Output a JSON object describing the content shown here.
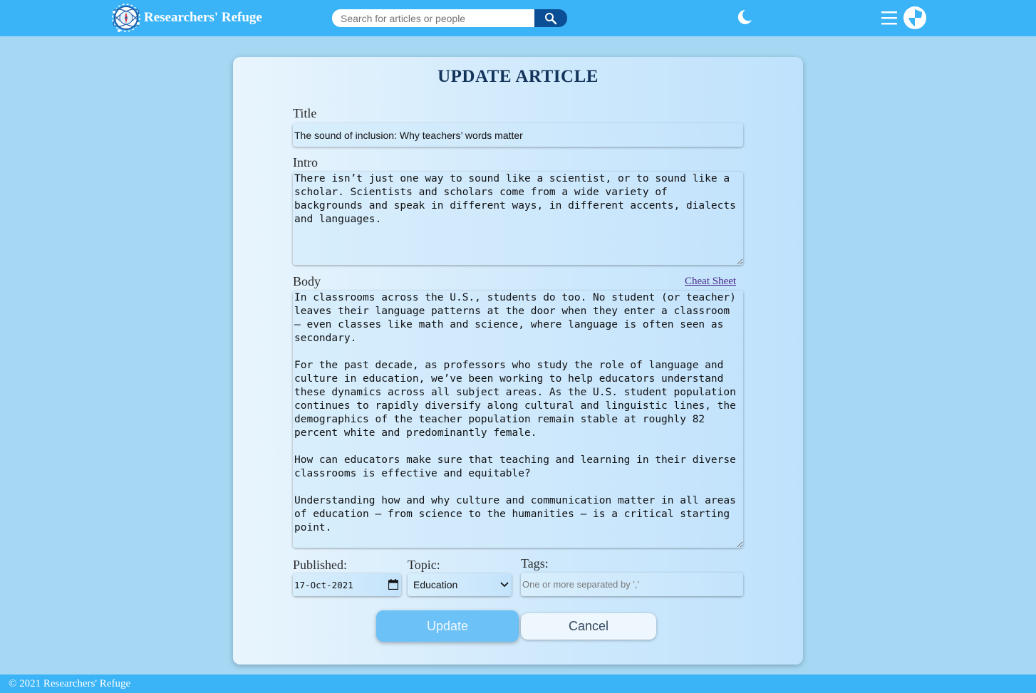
{
  "header": {
    "brand": "Researchers' Refuge",
    "search": {
      "placeholder": "Search for articles or people",
      "value": ""
    },
    "icons": [
      "logo-icon",
      "search-icon",
      "moon-icon",
      "menu-icon",
      "shield-icon"
    ]
  },
  "form": {
    "heading": "UPDATE ARTICLE",
    "title_label": "Title",
    "title_value": "The sound of inclusion: Why teachers’ words matter",
    "intro_label": "Intro",
    "intro_value": "There isn’t just one way to sound like a scientist, or to sound like a scholar. Scientists and scholars come from a wide variety of backgrounds and speak in different ways, in different accents, dialects and languages.",
    "body_label": "Body",
    "cheat_sheet": "Cheat Sheet",
    "body_value": "In classrooms across the U.S., students do too. No student (or teacher) leaves their language patterns at the door when they enter a classroom – even classes like math and science, where language is often seen as secondary.\n\nFor the past decade, as professors who study the role of language and culture in education, we’ve been working to help educators understand these dynamics across all subject areas. As the U.S. student population continues to rapidly diversify along cultural and linguistic lines, the demographics of the teacher population remain stable at roughly 82 percent white and predominantly female.\n\nHow can educators make sure that teaching and learning in their diverse classrooms is effective and equitable?\n\nUnderstanding how and why culture and communication matter in all areas of education – from science to the humanities – is a critical starting point.",
    "published_label": "Published:",
    "published_value": "17-Oct-2021",
    "topic_label": "Topic:",
    "topic_value": "Education",
    "tags_label": "Tags:",
    "tags_placeholder": "One or more separated by ','",
    "update_label": "Update",
    "cancel_label": "Cancel"
  },
  "footer": {
    "copyright": "© 2021 Researchers' Refuge"
  },
  "colors": {
    "header_bg": "#3bb3f7",
    "page_bg": "#a6d8f4",
    "heading": "#13335a",
    "search_button": "#0b4e95",
    "update_button": "#6cc1f6"
  }
}
